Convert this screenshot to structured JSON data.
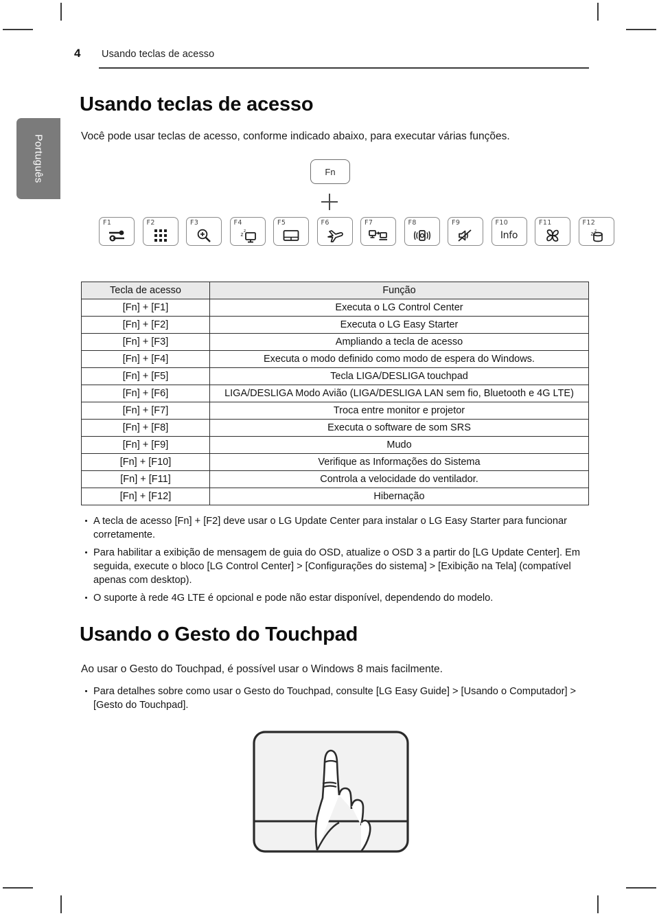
{
  "header": {
    "page_number": "4",
    "title": "Usando teclas de acesso"
  },
  "side_tab": {
    "label": "Português"
  },
  "sections": {
    "hotkeys": {
      "heading": "Usando teclas de acesso",
      "lead": "Você pode usar teclas de acesso, conforme indicado abaixo, para executar várias funções."
    },
    "gesture": {
      "heading": "Usando o Gesto do Touchpad",
      "lead": "Ao usar o Gesto do Touchpad, é possível usar o Windows 8  mais facilmente."
    }
  },
  "diagram": {
    "fn_key_label": "Fn",
    "plus_symbol": "+",
    "function_keys": [
      {
        "label": "F1",
        "icon": "settings-sliders-icon"
      },
      {
        "label": "F2",
        "icon": "app-grid-icon"
      },
      {
        "label": "F3",
        "icon": "magnifier-zoom-in-icon"
      },
      {
        "label": "F4",
        "icon": "monitor-sleep-icon"
      },
      {
        "label": "F5",
        "icon": "touchpad-icon"
      },
      {
        "label": "F6",
        "icon": "airplane-icon"
      },
      {
        "label": "F7",
        "icon": "monitor-projector-switch-icon"
      },
      {
        "label": "F8",
        "icon": "sound-srs-icon"
      },
      {
        "label": "F9",
        "icon": "mute-speaker-icon"
      },
      {
        "label": "F10",
        "icon": "info-text-icon",
        "text": "Info"
      },
      {
        "label": "F11",
        "icon": "fan-icon"
      },
      {
        "label": "F12",
        "icon": "hibernate-icon"
      }
    ]
  },
  "table": {
    "columns": [
      "Tecla de acesso",
      "Função"
    ],
    "rows": [
      [
        "[Fn] + [F1]",
        "Executa o LG Control Center"
      ],
      [
        "[Fn] + [F2]",
        "Executa o LG Easy Starter"
      ],
      [
        "[Fn] + [F3]",
        "Ampliando a tecla de acesso"
      ],
      [
        "[Fn] + [F4]",
        "Executa o modo definido como modo de espera do Windows."
      ],
      [
        "[Fn] + [F5]",
        "Tecla LIGA/DESLIGA touchpad"
      ],
      [
        "[Fn] + [F6]",
        "LIGA/DESLIGA Modo Avião (LIGA/DESLIGA LAN sem fio, Bluetooth e 4G LTE)"
      ],
      [
        "[Fn] + [F7]",
        "Troca entre monitor e projetor"
      ],
      [
        "[Fn] + [F8]",
        "Executa o software de som SRS"
      ],
      [
        "[Fn] + [F9]",
        "Mudo"
      ],
      [
        "[Fn] + [F10]",
        "Verifique as Informações do Sistema"
      ],
      [
        "[Fn] + [F11]",
        "Controla a velocidade do ventilador."
      ],
      [
        "[Fn] + [F12]",
        "Hibernação"
      ]
    ]
  },
  "notes_hotkeys": [
    "A tecla de acesso [Fn] + [F2] deve usar o LG Update Center para instalar o LG Easy Starter para funcionar corretamente.",
    "Para habilitar a exibição de mensagem de guia do OSD, atualize o OSD 3 a partir do [LG Update Center]. Em seguida, execute o bloco [LG Control Center] > [Configurações do sistema] > [Exibição na Tela] (compatível apenas com desktop).",
    "O suporte à rede 4G LTE é opcional e pode não estar disponível, dependendo do modelo."
  ],
  "notes_gesture": [
    "Para detalhes sobre como usar o Gesto do Touchpad, consulte [LG Easy Guide] > [Usando o Computador] > [Gesto do Touchpad]."
  ],
  "colors": {
    "side_tab": "#7b7b7b",
    "table_header": "#e9e9e9",
    "rule": "#3a3a3a"
  }
}
